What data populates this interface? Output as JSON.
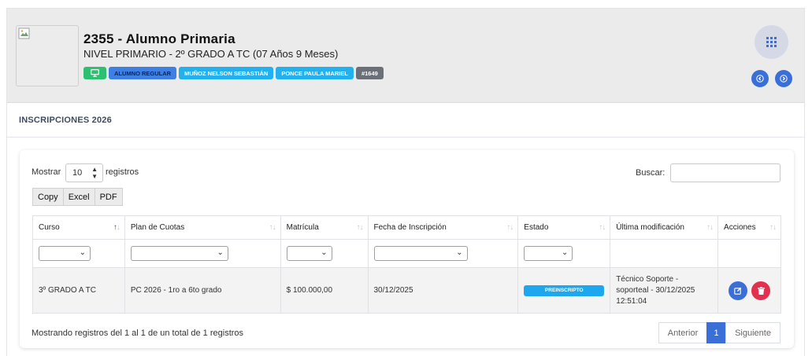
{
  "student": {
    "title": "2355 - Alumno Primaria",
    "subtitle": "NIVEL PRIMARIO - 2º GRADO A TC (07 Años 9 Meses)",
    "badges": [
      "ALUMNO REGULAR",
      "MUÑOZ NELSON SEBASTIÁN",
      "PONCE PAULA MARIEL",
      "#1649"
    ]
  },
  "section": {
    "title": "INSCRIPCIONES 2026"
  },
  "table_controls": {
    "show_label": "Mostrar",
    "page_length": "10",
    "records_label": "registros",
    "search_label": "Buscar:",
    "export_buttons": [
      "Copy",
      "Excel",
      "PDF"
    ]
  },
  "table": {
    "columns": [
      "Curso",
      "Plan de Cuotas",
      "Matrícula",
      "Fecha de Inscripción",
      "Estado",
      "Última modificación",
      "Acciones"
    ],
    "rows": [
      {
        "curso": "3º GRADO A TC",
        "plan": "PC 2026 - 1ro a 6to grado",
        "matricula": "$ 100.000,00",
        "fecha": "30/12/2025",
        "estado": "PREINSCRIPTO",
        "modificacion": "Técnico Soporte - soporteal - 30/12/2025 12:51:04"
      }
    ]
  },
  "footer": {
    "info": "Mostrando registros del 1 al 1 de un total de 1 registros",
    "prev_label": "Anterior",
    "current_page": "1",
    "next_label": "Siguiente"
  },
  "colors": {
    "primary": "#3b6fd8",
    "success": "#2fbf71",
    "info": "#22b1ee",
    "danger": "#e3304f",
    "secondary": "#6b6f78"
  }
}
